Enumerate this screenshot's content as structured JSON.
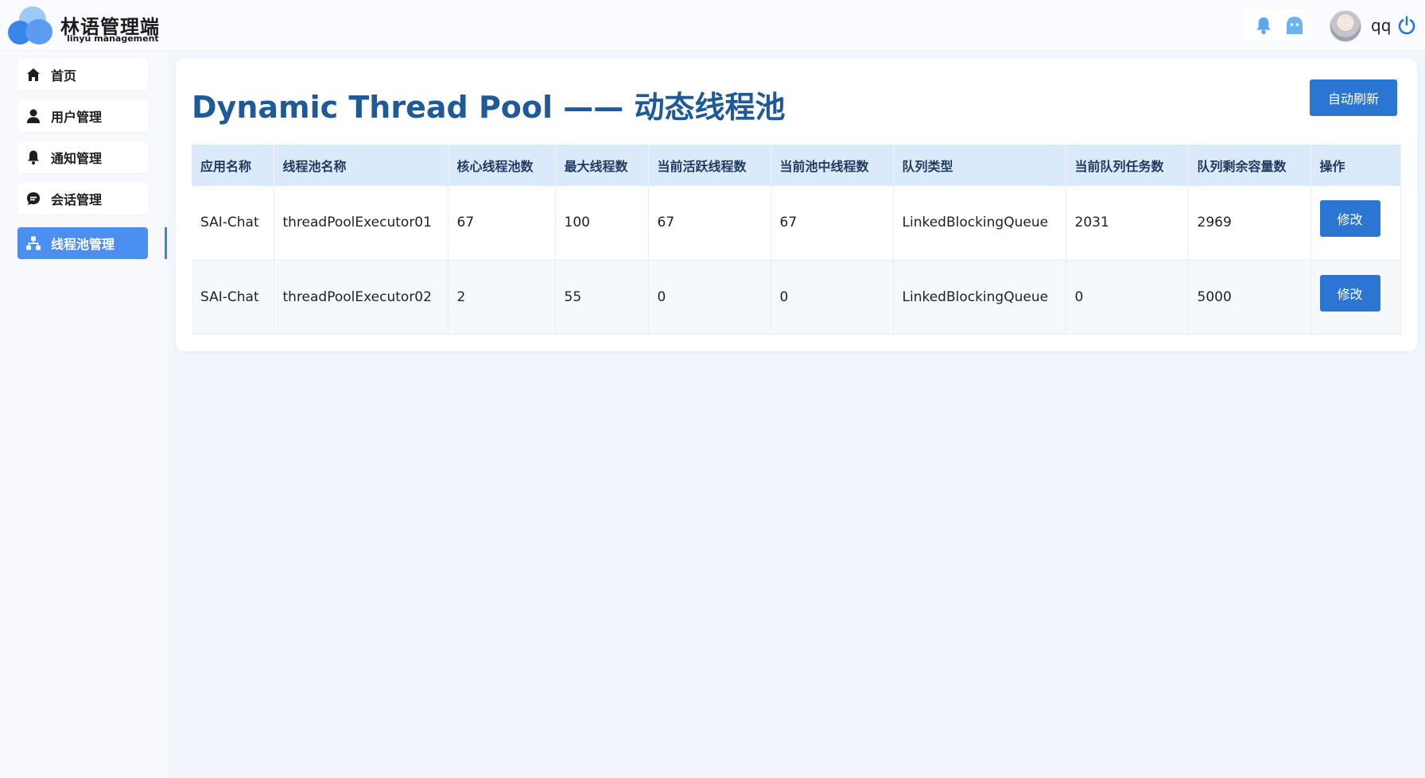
{
  "brand": {
    "title": "林语管理端",
    "subtitle": "linyu management"
  },
  "header": {
    "username": "qq",
    "icons": [
      "bell-icon",
      "ghost-icon",
      "avatar",
      "power-icon"
    ]
  },
  "sidebar": {
    "items": [
      {
        "label": "首页",
        "icon": "home-icon",
        "active": false
      },
      {
        "label": "用户管理",
        "icon": "user-icon",
        "active": false
      },
      {
        "label": "通知管理",
        "icon": "bell-icon",
        "active": false
      },
      {
        "label": "会话管理",
        "icon": "chat-icon",
        "active": false
      },
      {
        "label": "线程池管理",
        "icon": "network-icon",
        "active": true
      }
    ]
  },
  "main": {
    "title": "Dynamic Thread Pool —— 动态线程池",
    "refresh_label": "自动刷新",
    "table": {
      "columns": [
        "应用名称",
        "线程池名称",
        "核心线程池数",
        "最大线程数",
        "当前活跃线程数",
        "当前池中线程数",
        "队列类型",
        "当前队列任务数",
        "队列剩余容量数",
        "操作"
      ],
      "rows": [
        [
          "SAI-Chat",
          "threadPoolExecutor01",
          "67",
          "100",
          "67",
          "67",
          "LinkedBlockingQueue",
          "2031",
          "2969"
        ],
        [
          "SAI-Chat",
          "threadPoolExecutor02",
          "2",
          "55",
          "0",
          "0",
          "LinkedBlockingQueue",
          "0",
          "5000"
        ]
      ],
      "action_label": "修改"
    }
  },
  "colors": {
    "accent": "#2a76d2",
    "sidebar_active": "#4b8ff0",
    "title": "#1f5a98",
    "table_header_bg": "#dbeafb",
    "page_bg": "#f2f6fc"
  }
}
